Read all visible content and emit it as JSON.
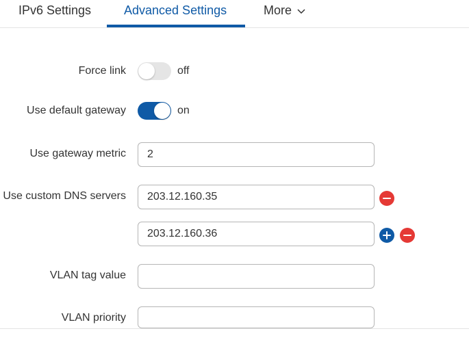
{
  "tabs": {
    "ipv6": "IPv6 Settings",
    "advanced": "Advanced Settings",
    "more": "More"
  },
  "settings": {
    "force_link": {
      "label": "Force link",
      "state": "off"
    },
    "default_gateway": {
      "label": "Use default gateway",
      "state": "on"
    },
    "gateway_metric": {
      "label": "Use gateway metric",
      "value": "2"
    },
    "dns": {
      "label": "Use custom DNS servers",
      "servers": [
        "203.12.160.35",
        "203.12.160.36"
      ]
    },
    "vlan_tag": {
      "label": "VLAN tag value",
      "value": ""
    },
    "vlan_priority": {
      "label": "VLAN priority",
      "value": ""
    }
  },
  "colors": {
    "accent": "#0f5aa6",
    "remove": "#e53935",
    "toggle_off": "#e5e5e5"
  }
}
